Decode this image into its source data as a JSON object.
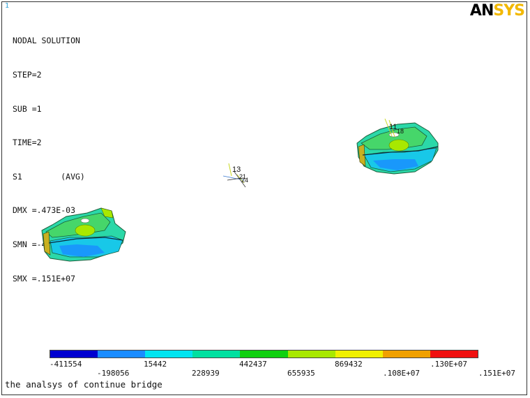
{
  "window_number": "1",
  "logo": {
    "part1": "AN",
    "part2": "SYS"
  },
  "info": {
    "title": "NODAL SOLUTION",
    "lines": [
      "STEP=2",
      "SUB =1",
      "TIME=2",
      "S1        (AVG)",
      "DMX =.473E-03",
      "SMN =-411554",
      "SMX =.151E+07"
    ]
  },
  "node_labels": [
    "11",
    "18",
    "13",
    "21",
    "24"
  ],
  "legend": {
    "colors": [
      "#0000d0",
      "#1a8cff",
      "#00e4f0",
      "#00e0a0",
      "#10d010",
      "#a8e800",
      "#f0f000",
      "#f0a000",
      "#f01010"
    ],
    "labels_top": [
      "-411554",
      "15442",
      "442437",
      "869432",
      ".130E+07"
    ],
    "labels_bottom": [
      "-198056",
      "228939",
      "655935",
      ".108E+07",
      ".151E+07"
    ]
  },
  "footer": "the analsys of continue bridge"
}
